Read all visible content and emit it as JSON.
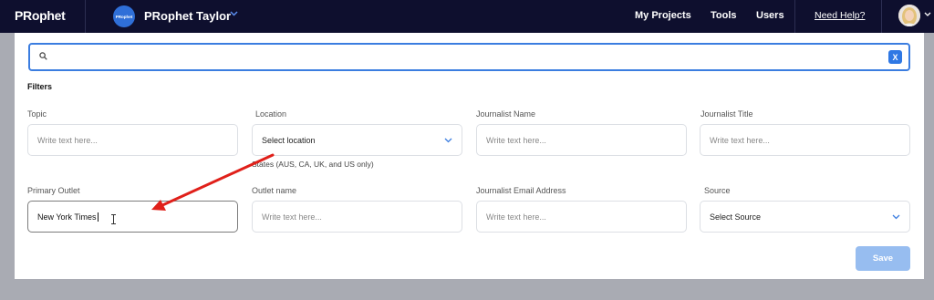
{
  "nav": {
    "logo": "PRophet",
    "workspace_badge": "PRophet",
    "workspace_name": "PRophet Taylor",
    "links": [
      "My Projects",
      "Tools",
      "Users"
    ],
    "help": "Need Help?"
  },
  "search": {
    "value": "",
    "clear_label": "X"
  },
  "filters": {
    "title": "Filters",
    "topic": {
      "label": "Topic",
      "placeholder": "Write text here..."
    },
    "location": {
      "label": "Location",
      "value": "Select location",
      "helper": "States (AUS, CA, UK, and US only)"
    },
    "journalist_name": {
      "label": "Journalist Name",
      "placeholder": "Write text here..."
    },
    "journalist_title": {
      "label": "Journalist Title",
      "placeholder": "Write text here..."
    },
    "primary_outlet": {
      "label": "Primary Outlet",
      "value": "New York Times"
    },
    "outlet_name": {
      "label": "Outlet name",
      "placeholder": "Write text here..."
    },
    "journalist_email": {
      "label": "Journalist Email Address",
      "placeholder": "Write text here..."
    },
    "source": {
      "label": "Source",
      "value": "Select Source"
    }
  },
  "save_label": "Save",
  "colors": {
    "nav_bg": "#0e0f2e",
    "accent": "#2f78e4",
    "annotation_arrow": "#e0201a",
    "save_disabled": "#97bdf0"
  }
}
